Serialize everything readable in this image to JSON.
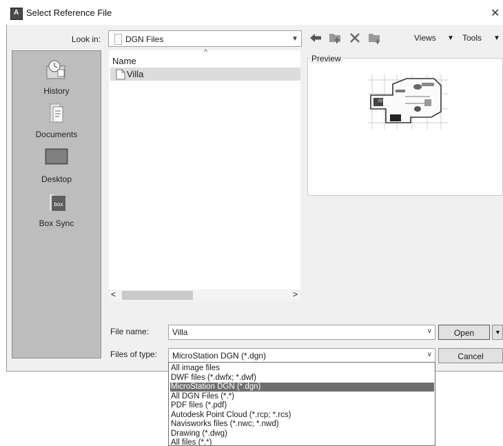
{
  "window": {
    "title": "Select Reference File",
    "close_glyph": "✕"
  },
  "toolbar": {
    "look_in_label": "Look in:",
    "look_in_value": "DGN Files",
    "views_label": "Views",
    "tools_label": "Tools"
  },
  "places": [
    {
      "label": "History",
      "icon": "history-icon"
    },
    {
      "label": "Documents",
      "icon": "documents-icon"
    },
    {
      "label": "Desktop",
      "icon": "desktop-icon"
    },
    {
      "label": "Box Sync",
      "icon": "box-sync-icon",
      "badge": "box"
    }
  ],
  "file_list": {
    "column_header": "Name",
    "items": [
      "Villa"
    ],
    "selected": "Villa"
  },
  "preview": {
    "label": "Preview"
  },
  "file_name": {
    "label": "File name:",
    "value": "Villa"
  },
  "file_type": {
    "label": "Files of type:",
    "value": "MicroStation DGN (*.dgn)",
    "options": [
      "All image files",
      "DWF files (*.dwfx; *.dwf)",
      "MicroStation DGN (*.dgn)",
      "All DGN Files (*.*)",
      "PDF files (*.pdf)",
      "Autodesk Point Cloud (*.rcp; *.rcs)",
      "Navisworks files (*.nwc; *.nwd)",
      "Drawing (*.dwg)",
      "All files (*.*)"
    ],
    "highlighted_index": 2
  },
  "buttons": {
    "open": "Open",
    "cancel": "Cancel"
  },
  "colors": {
    "places_bg": "#bdbdbd",
    "selection": "#6e6e6e",
    "dialog_bg": "#f0f0f0"
  }
}
